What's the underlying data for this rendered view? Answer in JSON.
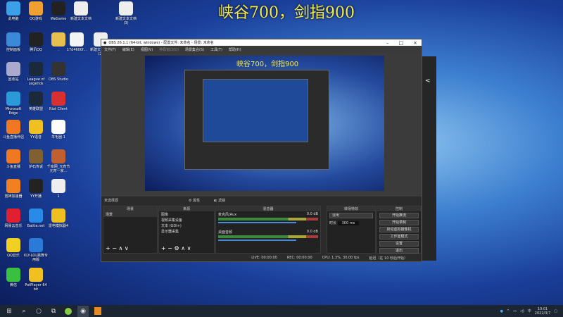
{
  "overlay_text": "峡谷700，剑指900",
  "desktop_icons": [
    {
      "label": "此电脑",
      "color": "#3aa0e8"
    },
    {
      "label": "QQ游戏",
      "color": "#f0a030"
    },
    {
      "label": "WeGame",
      "color": "#222"
    },
    {
      "label": "新建文本文档",
      "color": "#eee"
    },
    {
      "label": "新建文本文档\n(3)",
      "color": "#eee"
    },
    {
      "label": "控制面板",
      "color": "#3a8ad8"
    },
    {
      "label": "腾讯QQ",
      "color": "#222"
    },
    {
      "label": ".",
      "color": "#e8c050"
    },
    {
      "label": "17d4600f...",
      "color": "#f4f4f4"
    },
    {
      "label": "新建文本文档\n(2)",
      "color": "#eee"
    },
    {
      "label": "回收站",
      "color": "#aac"
    },
    {
      "label": "League of Legends",
      "color": "#1a2a3a"
    },
    {
      "label": "OBS Studio",
      "color": "#333"
    },
    {
      "label": "Microsoft Edge",
      "color": "#2a9ad8"
    },
    {
      "label": "英雄联盟",
      "color": "#1a2a3a"
    },
    {
      "label": "Riot Client",
      "color": "#d83030"
    },
    {
      "label": "斗鱼直播伴侣",
      "color": "#f07820"
    },
    {
      "label": "YY语音",
      "color": "#f0c020"
    },
    {
      "label": "羊毛圈-1",
      "color": "#fff"
    },
    {
      "label": "斗鱼直播",
      "color": "#f07820"
    },
    {
      "label": "炉石传说",
      "color": "#806030"
    },
    {
      "label": "千库网_元宵节元宵一家...",
      "color": "#c06030"
    },
    {
      "label": "雷神加速器",
      "color": "#f08020"
    },
    {
      "label": "YY开播",
      "color": "#222"
    },
    {
      "label": "1",
      "color": "#eee"
    },
    {
      "label": "网易云音乐",
      "color": "#e02030"
    },
    {
      "label": "Battle.net",
      "color": "#2a8ae8"
    },
    {
      "label": "雷电模拟器4",
      "color": "#f0c020"
    },
    {
      "label": "QQ音乐",
      "color": "#f0d020"
    },
    {
      "label": "KLY-LOL跳舞专用版",
      "color": "#2a7ad8"
    },
    {
      "label": "微信",
      "color": "#3ac040"
    },
    {
      "label": "PotPlayer 64 bit",
      "color": "#f0c020"
    }
  ],
  "obs": {
    "title": "OBS 26.1.1 (64-bit, windows) - 配置文件: 未命名 - 场景: 未命名",
    "menu": [
      "文件(F)",
      "编辑(E)",
      "视图(V)",
      "停靠窗口(D)",
      "场景集合(S)",
      "工具(T)",
      "帮助(H)"
    ],
    "preview_text": "峡谷700，剑指900",
    "no_source": "未选择源",
    "properties": "属性",
    "filters": "滤镜",
    "scenes_header": "场景",
    "scenes": [
      "场景"
    ],
    "sources_header": "来源",
    "sources": [
      "图像",
      "视频采集设备",
      "文本 (GDI+)",
      "显示器采集"
    ],
    "mixer_header": "混音器",
    "mixer": [
      {
        "name": "麦克风/Aux",
        "db": "0.0 dB"
      },
      {
        "name": "桌面音频",
        "db": "0.0 dB"
      }
    ],
    "transitions_header": "转场特效",
    "transition": "淡出",
    "duration_label": "时长",
    "duration": "300 ms",
    "controls_header": "控制",
    "controls": [
      "开始推流",
      "开始录制",
      "启动虚拟摄像机",
      "工作室模式",
      "设置",
      "退出"
    ],
    "status": [
      "LIVE: 00:00:00",
      "REC: 00:00:00",
      "CPU: 1.3%, 30.00 fps",
      "延迟（在 10 秒后开始）"
    ]
  },
  "taskbar": {
    "time": "10:01",
    "date": "2022/3/7"
  }
}
